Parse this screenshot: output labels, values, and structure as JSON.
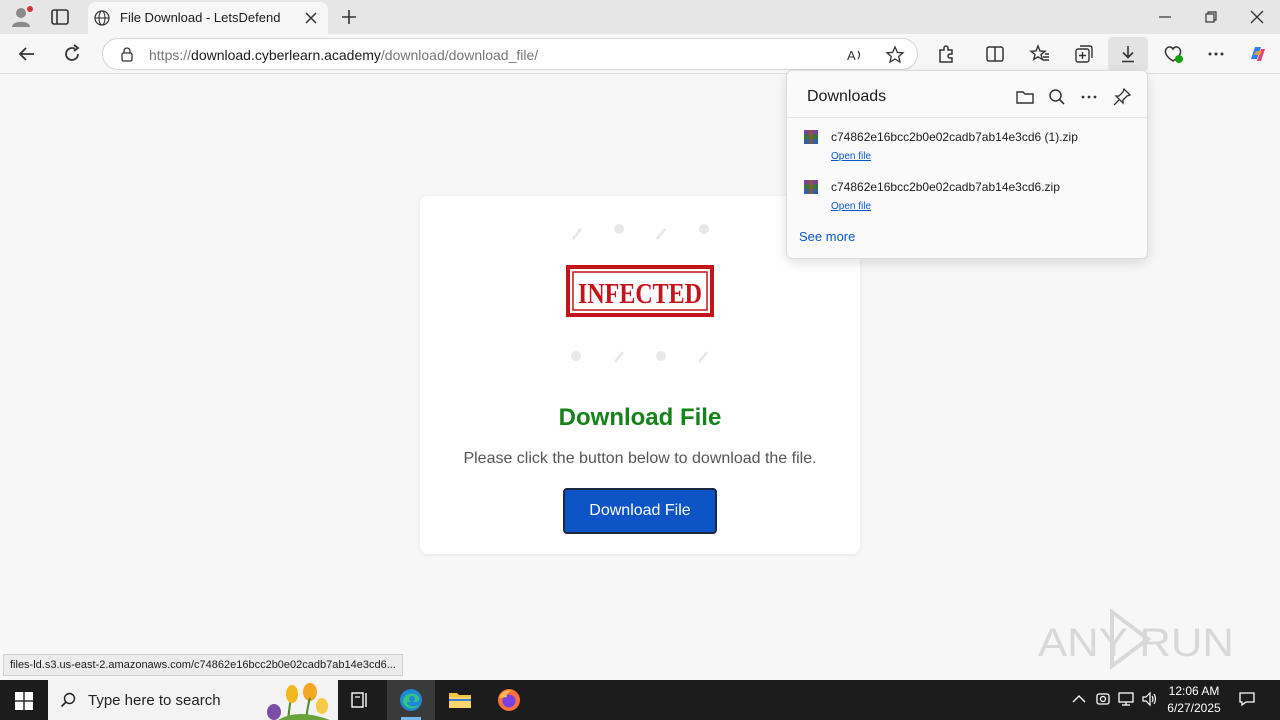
{
  "browser": {
    "tab_title": "File Download - LetsDefend",
    "url_prefix": "https://",
    "url_host": "download.cyberlearn.academy",
    "url_path": "/download/download_file/"
  },
  "page": {
    "stamp_text": "INFECTED",
    "heading": "Download File",
    "description": "Please click the button below to download the file.",
    "button_label": "Download File",
    "heading_color": "#15821a",
    "button_color": "#0d55c6"
  },
  "downloads": {
    "title": "Downloads",
    "items": [
      {
        "filename": "c74862e16bcc2b0e02cadb7ab14e3cd6 (1).zip",
        "action": "Open file"
      },
      {
        "filename": "c74862e16bcc2b0e02cadb7ab14e3cd6.zip",
        "action": "Open file"
      }
    ],
    "see_more": "See more"
  },
  "status_bar": {
    "link": "files-ld.s3.us-east-2.amazonaws.com/c74862e16bcc2b0e02cadb7ab14e3cd6..."
  },
  "watermark": "ANY RUN",
  "taskbar": {
    "search_placeholder": "Type here to search",
    "time": "12:06 AM",
    "date": "6/27/2025"
  }
}
